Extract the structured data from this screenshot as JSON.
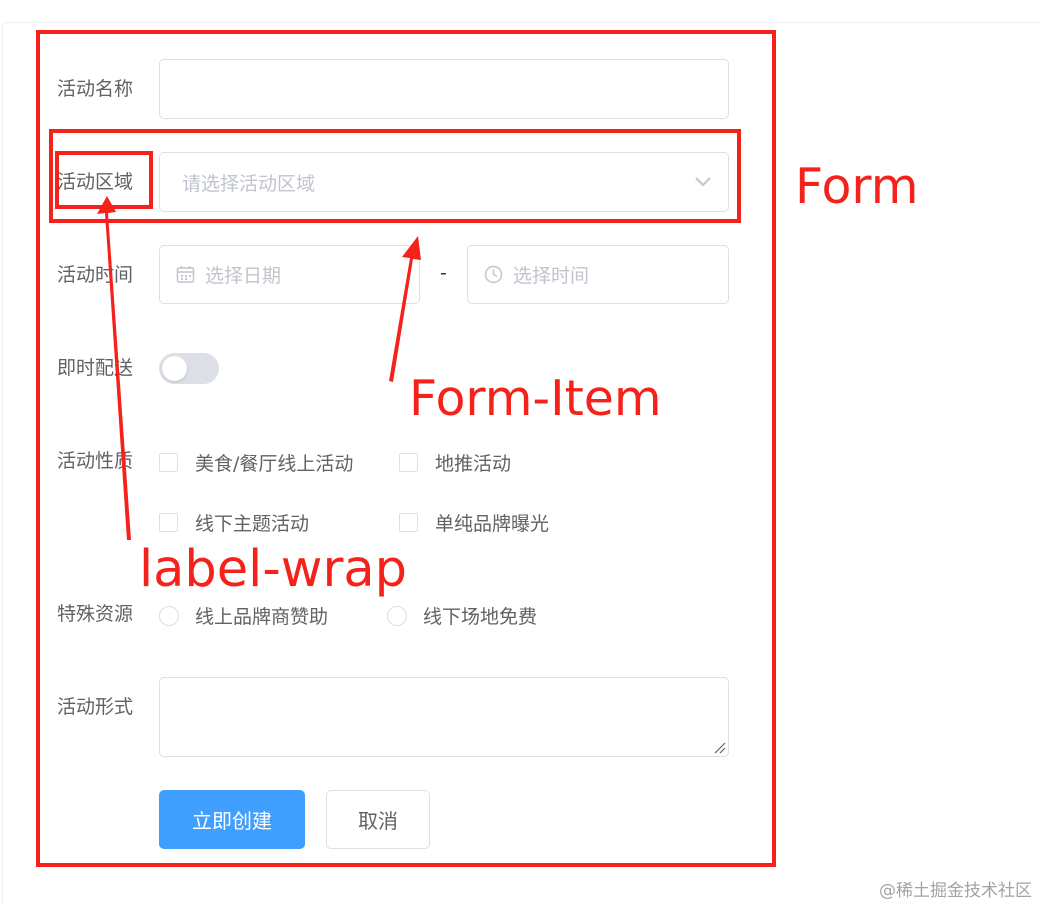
{
  "form": {
    "name": {
      "label": "活动名称",
      "value": ""
    },
    "region": {
      "label": "活动区域",
      "placeholder": "请选择活动区域"
    },
    "time": {
      "label": "活动时间",
      "date_placeholder": "选择日期",
      "separator": "-",
      "time_placeholder": "选择时间"
    },
    "delivery": {
      "label": "即时配送",
      "on": false
    },
    "type": {
      "label": "活动性质",
      "options": [
        "美食/餐厅线上活动",
        "地推活动",
        "线下主题活动",
        "单纯品牌曝光"
      ]
    },
    "resource": {
      "label": "特殊资源",
      "options": [
        "线上品牌商赞助",
        "线下场地免费"
      ]
    },
    "desc": {
      "label": "活动形式",
      "value": ""
    },
    "buttons": {
      "submit": "立即创建",
      "cancel": "取消"
    }
  },
  "annotations": {
    "form": "Form",
    "form_item": "Form-Item",
    "label_wrap": "label-wrap"
  },
  "watermark": "@稀土掘金技术社区",
  "colors": {
    "primary": "#409eff",
    "annotation_red": "#f5221b",
    "border": "#dcdfe6",
    "placeholder": "#c0c4cc",
    "label": "#606266"
  }
}
